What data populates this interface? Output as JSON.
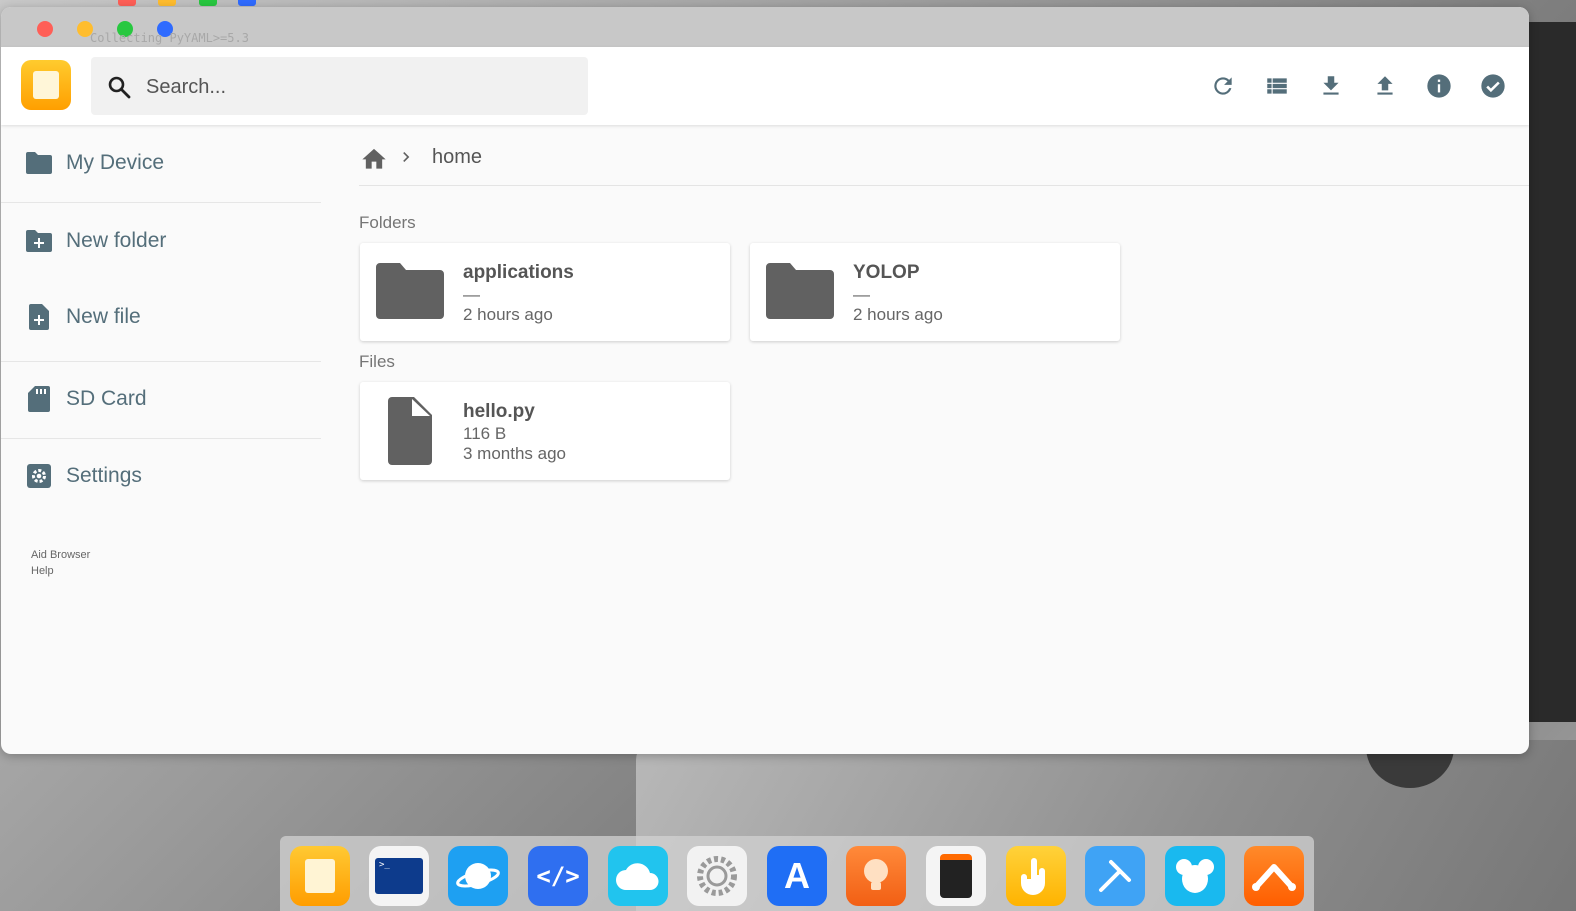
{
  "window": {
    "titlebar_text": "Collecting PyYAML>=5.3"
  },
  "search": {
    "placeholder": "Search..."
  },
  "toolbar": {
    "icons": [
      "refresh-icon",
      "list-view-icon",
      "download-icon",
      "upload-icon",
      "info-icon",
      "select-icon"
    ]
  },
  "sidebar": {
    "items": [
      {
        "label": "My Device",
        "icon": "folder-icon"
      },
      {
        "label": "New folder",
        "icon": "new-folder-icon"
      },
      {
        "label": "New file",
        "icon": "new-file-icon"
      },
      {
        "label": "SD Card",
        "icon": "sd-card-icon"
      },
      {
        "label": "Settings",
        "icon": "settings-icon"
      }
    ],
    "footer": [
      "Aid Browser",
      "Help"
    ]
  },
  "breadcrumb": {
    "home_icon": "home-icon",
    "current": "home"
  },
  "main": {
    "folders_label": "Folders",
    "files_label": "Files",
    "folders": [
      {
        "name": "applications",
        "size": "—",
        "modified": "2 hours ago"
      },
      {
        "name": "YOLOP",
        "size": "—",
        "modified": "2 hours ago"
      }
    ],
    "files": [
      {
        "name": "hello.py",
        "size": "116 B",
        "modified": "3 months ago"
      }
    ]
  },
  "dock": {
    "apps": [
      "files-app-icon",
      "terminal-app-icon",
      "browser-app-icon",
      "code-editor-app-icon",
      "cloud-app-icon",
      "settings-app-icon",
      "app-store-icon",
      "tips-app-icon",
      "calculator-app-icon",
      "touch-app-icon",
      "tools-app-icon",
      "mouse-app-icon",
      "network-app-icon"
    ]
  },
  "colors": {
    "accent": "#ff9f00",
    "sidebar_text": "#546e7a",
    "icon_gray": "#616161",
    "traffic_red": "#ff5f57",
    "traffic_yellow": "#ffbd2e",
    "traffic_green": "#28c840",
    "traffic_blue": "#2f6bff"
  }
}
